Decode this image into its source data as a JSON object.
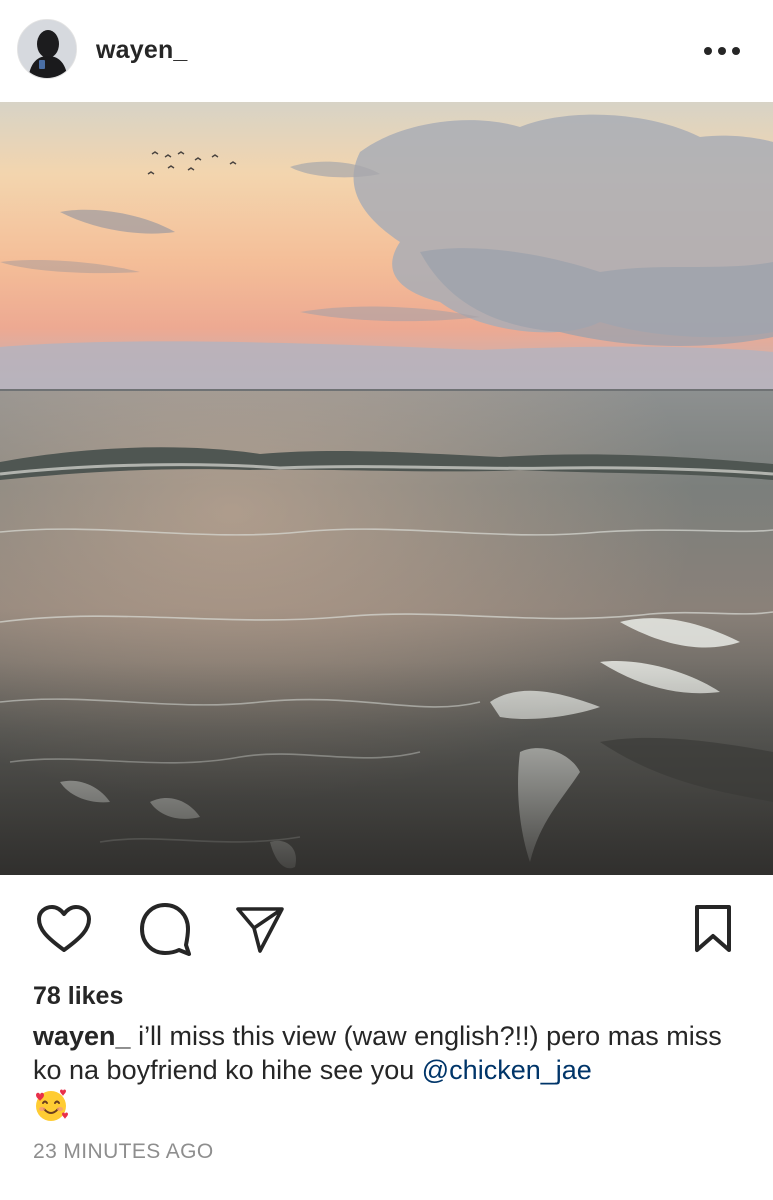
{
  "header": {
    "username": "wayen_",
    "more_icon": "more-horizontal-icon"
  },
  "post": {
    "image_description": "sunset beach",
    "actions": {
      "like_icon": "heart-icon",
      "comment_icon": "comment-bubble-icon",
      "share_icon": "paper-plane-icon",
      "save_icon": "bookmark-icon"
    },
    "likes_text": "78 likes",
    "caption": {
      "username": "wayen_",
      "text": " i’ll miss this view (waw english?!!) pero mas miss ko na boyfriend ko hihe see you ",
      "mention": "@chicken_jae",
      "emoji": "🥰"
    },
    "timestamp": "23 MINUTES AGO"
  },
  "colors": {
    "text": "#262626",
    "mention": "#003569",
    "muted": "#8e8e8e"
  }
}
